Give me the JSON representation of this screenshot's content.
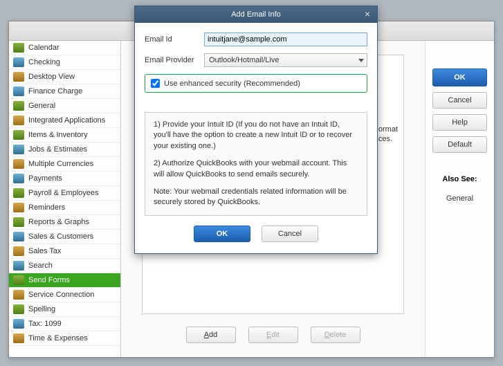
{
  "modal": {
    "title": "Add Email Info",
    "fields": {
      "email_id_label": "Email Id",
      "email_id_value": "intuitjane@sample.com",
      "provider_label": "Email Provider",
      "provider_value": "Outlook/Hotmail/Live",
      "enhanced_security_label": "Use enhanced security (Recommended)"
    },
    "info": {
      "p1": "1) Provide your Intuit ID (If you do not have an Intuit ID, you'll have the option to create a new Intuit ID or to recover your existing one.)",
      "p2": "2) Authorize QuickBooks with your webmail account. This will allow QuickBooks to send emails securely.",
      "note": "Note: Your webmail credentials related  information will be  securely stored by QuickBooks."
    },
    "buttons": {
      "ok": "OK",
      "cancel": "Cancel"
    }
  },
  "sidebar": {
    "items": [
      {
        "label": "Calendar"
      },
      {
        "label": "Checking"
      },
      {
        "label": "Desktop View"
      },
      {
        "label": "Finance Charge"
      },
      {
        "label": "General"
      },
      {
        "label": "Integrated Applications"
      },
      {
        "label": "Items & Inventory"
      },
      {
        "label": "Jobs & Estimates"
      },
      {
        "label": "Multiple Currencies"
      },
      {
        "label": "Payments"
      },
      {
        "label": "Payroll & Employees"
      },
      {
        "label": "Reminders"
      },
      {
        "label": "Reports & Graphs"
      },
      {
        "label": "Sales & Customers"
      },
      {
        "label": "Sales Tax"
      },
      {
        "label": "Search"
      },
      {
        "label": "Send Forms"
      },
      {
        "label": "Service Connection"
      },
      {
        "label": "Spelling"
      },
      {
        "label": "Tax: 1099"
      },
      {
        "label": "Time & Expenses"
      }
    ],
    "selected_index": 16
  },
  "main": {
    "hint_line1": "ormat",
    "hint_line2": "ces.",
    "buttons": {
      "add": "dd",
      "add_prefix": "A",
      "edit": "dit",
      "edit_prefix": "E",
      "delete": "elete",
      "delete_prefix": "D"
    }
  },
  "right": {
    "ok": "OK",
    "cancel": "Cancel",
    "help": "Help",
    "default": "Default",
    "also_see": "Also See:",
    "general": "General"
  }
}
